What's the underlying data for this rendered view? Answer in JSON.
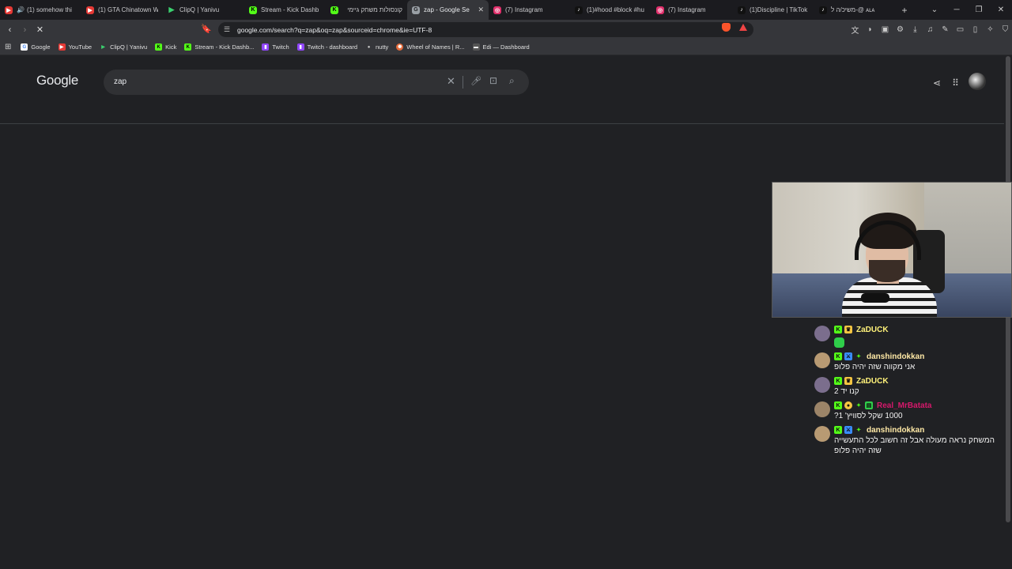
{
  "tabs": [
    {
      "title": "(1) somehow thi",
      "favicon_color": "#e53935",
      "audio": true
    },
    {
      "title": "(1) GTA Chinatown W",
      "favicon_color": "#e53935"
    },
    {
      "title": "ClipQ | Yanivu",
      "favicon_color": "#3bd16f"
    },
    {
      "title": "Stream - Kick Dashb",
      "favicon_color": "#53fc18"
    },
    {
      "title": "קונסולות משחק גיימי",
      "favicon_color": "#53fc18"
    },
    {
      "title": "zap - Google Se",
      "favicon_color": "#9aa0a6",
      "active": true
    },
    {
      "title": "(7) Instagram",
      "favicon_color": "#e1306c"
    },
    {
      "title": "(1)#hood #block #hu",
      "favicon_color": "#111111"
    },
    {
      "title": "(7) Instagram",
      "favicon_color": "#e1306c"
    },
    {
      "title": "(1)Discipline | TikTok",
      "favicon_color": "#111111"
    },
    {
      "title": "משיכ/ה ל-@ ᴀʟᴀ",
      "favicon_color": "#111111"
    }
  ],
  "toolbar": {
    "url": "google.com/search?q=zap&oq=zap&sourceid=chrome&ie=UTF-8"
  },
  "bookmarks": [
    {
      "label": "Google",
      "color": "#4285f4"
    },
    {
      "label": "YouTube",
      "color": "#e53935"
    },
    {
      "label": "ClipQ | Yanivu",
      "color": "#3bd16f"
    },
    {
      "label": "Kick",
      "color": "#53fc18"
    },
    {
      "label": "Stream - Kick Dashb...",
      "color": "#53fc18"
    },
    {
      "label": "Twitch",
      "color": "#9146ff"
    },
    {
      "label": "Twitch - dashboard",
      "color": "#9146ff"
    },
    {
      "label": "nutty",
      "color": "#cccccc"
    },
    {
      "label": "Wheel of Names | R...",
      "color": "#e66b3a"
    },
    {
      "label": "Edi — Dashboard",
      "color": "#cccccc"
    }
  ],
  "google": {
    "logo": "Google",
    "query": "zap"
  },
  "chat": [
    {
      "user": "ZaDUCK",
      "user_color": "#fff27a",
      "text": "",
      "emote": true,
      "avatar": "#7b6e8d"
    },
    {
      "user": "danshindokkan",
      "user_color": "#ffe9a6",
      "text": "אני מקווה שזה יהיה פלופ",
      "avatar": "#b89a73"
    },
    {
      "user": "ZaDUCK",
      "user_color": "#fff27a",
      "text": "קנו יד 2",
      "avatar": "#7b6e8d"
    },
    {
      "user": "Real_MrBatata",
      "user_color": "#d6186b",
      "text": "1000 שקל לסוויץ' 1?",
      "avatar": "#9c8468"
    },
    {
      "user": "danshindokkan",
      "user_color": "#ffe9a6",
      "text": "המשחק נראה מעולה אבל זה חשוב לכל התעשייה שזה יהיה פלופ",
      "avatar": "#b89a73"
    }
  ]
}
